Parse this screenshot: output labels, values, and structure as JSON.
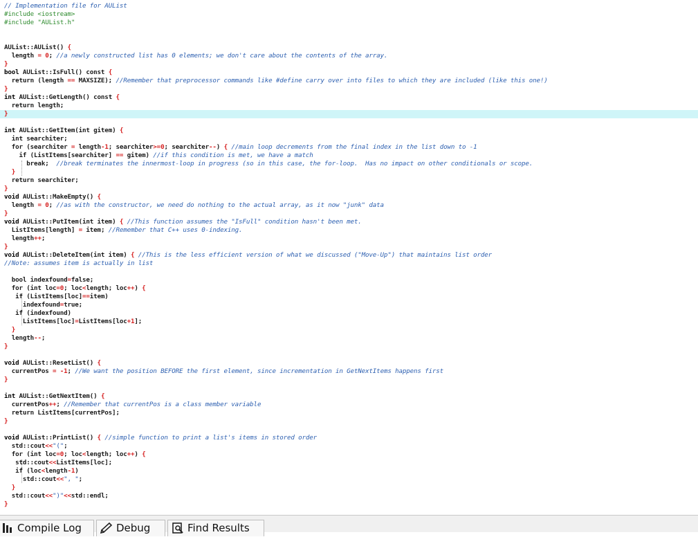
{
  "editor": {
    "highlighted_line": 13,
    "lines": [
      [
        [
          "cmt",
          "// Implementation file for AUList"
        ]
      ],
      [
        [
          "pp",
          "#include <iostream>"
        ]
      ],
      [
        [
          "pp",
          "#include \"AUList.h\""
        ]
      ],
      [],
      [],
      [
        [
          "txt",
          "AUList::AUList() "
        ],
        [
          "sym",
          "{"
        ]
      ],
      [
        [
          "txt",
          "  length "
        ],
        [
          "sym",
          "="
        ],
        [
          "txt",
          " "
        ],
        [
          "num",
          "0"
        ],
        [
          "txt",
          "; "
        ],
        [
          "cmt",
          "//a newly constructed list has 0 elements; we don't care about the contents of the array."
        ]
      ],
      [
        [
          "sym",
          "}"
        ]
      ],
      [
        [
          "kw",
          "bool"
        ],
        [
          "txt",
          " AUList::IsFull() const "
        ],
        [
          "sym",
          "{"
        ]
      ],
      [
        [
          "txt",
          "  return (length "
        ],
        [
          "sym",
          "=="
        ],
        [
          "txt",
          " MAXSIZE); "
        ],
        [
          "cmt",
          "//Remember that preprocessor commands like #define carry over into files to which they are included (like this one!)"
        ]
      ],
      [
        [
          "sym",
          "}"
        ]
      ],
      [
        [
          "kw",
          "int"
        ],
        [
          "txt",
          " AUList::GetLength() const "
        ],
        [
          "sym",
          "{"
        ]
      ],
      [
        [
          "txt",
          "  return length;"
        ]
      ],
      [
        [
          "sym",
          "}"
        ]
      ],
      [],
      [
        [
          "kw",
          "int"
        ],
        [
          "txt",
          " AUList::GetItem(int gitem) "
        ],
        [
          "sym",
          "{"
        ]
      ],
      [
        [
          "txt",
          "  int searchiter;"
        ]
      ],
      [
        [
          "txt",
          "  for (searchiter "
        ],
        [
          "sym",
          "="
        ],
        [
          "txt",
          " length"
        ],
        [
          "sym",
          "-"
        ],
        [
          "num",
          "1"
        ],
        [
          "txt",
          "; searchiter"
        ],
        [
          "sym",
          ">="
        ],
        [
          "num",
          "0"
        ],
        [
          "txt",
          "; searchiter"
        ],
        [
          "sym",
          "--"
        ],
        [
          "txt",
          ") "
        ],
        [
          "sym",
          "{"
        ],
        [
          "txt",
          " "
        ],
        [
          "cmt",
          "//main loop decrements from the final index in the list down to -1"
        ]
      ],
      [
        [
          "txt",
          "    if (ListItems[searchiter] "
        ],
        [
          "sym",
          "=="
        ],
        [
          "txt",
          " gitem) "
        ],
        [
          "cmt",
          "//if this condition is met, we have a match"
        ]
      ],
      [
        [
          "txt",
          "      break;  "
        ],
        [
          "cmt",
          "//break terminates the innermost-loop in progress (so in this case, the for-loop.  Has no impact on other conditionals or scope."
        ]
      ],
      [
        [
          "txt",
          "  "
        ],
        [
          "sym",
          "}"
        ]
      ],
      [
        [
          "txt",
          "  return searchiter;"
        ]
      ],
      [
        [
          "sym",
          "}"
        ]
      ],
      [
        [
          "kw",
          "void"
        ],
        [
          "txt",
          " AUList::MakeEmpty() "
        ],
        [
          "sym",
          "{"
        ]
      ],
      [
        [
          "txt",
          "  length "
        ],
        [
          "sym",
          "="
        ],
        [
          "txt",
          " "
        ],
        [
          "num",
          "0"
        ],
        [
          "txt",
          "; "
        ],
        [
          "cmt",
          "//as with the constructor, we need do nothing to the actual array, as it now \"junk\" data"
        ]
      ],
      [
        [
          "sym",
          "}"
        ]
      ],
      [
        [
          "kw",
          "void"
        ],
        [
          "txt",
          " AUList::PutItem(int item) "
        ],
        [
          "sym",
          "{"
        ],
        [
          "txt",
          " "
        ],
        [
          "cmt",
          "//This function assumes the \"IsFull\" condition hasn't been met."
        ]
      ],
      [
        [
          "txt",
          "  ListItems[length] "
        ],
        [
          "sym",
          "="
        ],
        [
          "txt",
          " item; "
        ],
        [
          "cmt",
          "//Remember that C++ uses 0-indexing."
        ]
      ],
      [
        [
          "txt",
          "  length"
        ],
        [
          "sym",
          "++"
        ],
        [
          "txt",
          ";"
        ]
      ],
      [
        [
          "sym",
          "}"
        ]
      ],
      [
        [
          "kw",
          "void"
        ],
        [
          "txt",
          " AUList::DeleteItem(int item) "
        ],
        [
          "sym",
          "{"
        ],
        [
          "txt",
          " "
        ],
        [
          "cmt",
          "//This is the less efficient version of what we discussed (\"Move-Up\") that maintains list order"
        ]
      ],
      [
        [
          "cmt",
          "//Note: assumes item is actually in list"
        ]
      ],
      [],
      [
        [
          "txt",
          "  bool indexfound"
        ],
        [
          "sym",
          "="
        ],
        [
          "txt",
          "false;"
        ]
      ],
      [
        [
          "txt",
          "  for (int loc"
        ],
        [
          "sym",
          "="
        ],
        [
          "num",
          "0"
        ],
        [
          "txt",
          "; loc"
        ],
        [
          "sym",
          "<"
        ],
        [
          "txt",
          "length; loc"
        ],
        [
          "sym",
          "++"
        ],
        [
          "txt",
          ") "
        ],
        [
          "sym",
          "{"
        ]
      ],
      [
        [
          "txt",
          "   if (ListItems[loc]"
        ],
        [
          "sym",
          "=="
        ],
        [
          "txt",
          "item)"
        ]
      ],
      [
        [
          "txt",
          "     indexfound"
        ],
        [
          "sym",
          "="
        ],
        [
          "txt",
          "true;"
        ]
      ],
      [
        [
          "txt",
          "   if (indexfound)"
        ]
      ],
      [
        [
          "txt",
          "     ListItems[loc]"
        ],
        [
          "sym",
          "="
        ],
        [
          "txt",
          "ListItems[loc"
        ],
        [
          "sym",
          "+"
        ],
        [
          "num",
          "1"
        ],
        [
          "txt",
          "];"
        ]
      ],
      [
        [
          "txt",
          "  "
        ],
        [
          "sym",
          "}"
        ]
      ],
      [
        [
          "txt",
          "  length"
        ],
        [
          "sym",
          "--"
        ],
        [
          "txt",
          ";"
        ]
      ],
      [
        [
          "sym",
          "}"
        ]
      ],
      [],
      [
        [
          "kw",
          "void"
        ],
        [
          "txt",
          " AUList::ResetList() "
        ],
        [
          "sym",
          "{"
        ]
      ],
      [
        [
          "txt",
          "  currentPos "
        ],
        [
          "sym",
          "="
        ],
        [
          "txt",
          " "
        ],
        [
          "sym",
          "-"
        ],
        [
          "num",
          "1"
        ],
        [
          "txt",
          "; "
        ],
        [
          "cmt",
          "//We want the position BEFORE the first element, since incrementation in GetNextItems happens first"
        ]
      ],
      [
        [
          "sym",
          "}"
        ]
      ],
      [],
      [
        [
          "kw",
          "int"
        ],
        [
          "txt",
          " AUList::GetNextItem() "
        ],
        [
          "sym",
          "{"
        ]
      ],
      [
        [
          "txt",
          "  currentPos"
        ],
        [
          "sym",
          "++"
        ],
        [
          "txt",
          "; "
        ],
        [
          "cmt",
          "//Remember that currentPos is a class member variable"
        ]
      ],
      [
        [
          "txt",
          "  return ListItems[currentPos];"
        ]
      ],
      [
        [
          "sym",
          "}"
        ]
      ],
      [],
      [
        [
          "kw",
          "void"
        ],
        [
          "txt",
          " AUList::PrintList() "
        ],
        [
          "sym",
          "{"
        ],
        [
          "txt",
          " "
        ],
        [
          "cmt",
          "//simple function to print a list's items in stored order"
        ]
      ],
      [
        [
          "txt",
          "  std::cout"
        ],
        [
          "sym",
          "<<"
        ],
        [
          "str",
          "\"(\""
        ],
        [
          "txt",
          ";"
        ]
      ],
      [
        [
          "txt",
          "  for (int loc"
        ],
        [
          "sym",
          "="
        ],
        [
          "num",
          "0"
        ],
        [
          "txt",
          "; loc"
        ],
        [
          "sym",
          "<"
        ],
        [
          "txt",
          "length; loc"
        ],
        [
          "sym",
          "++"
        ],
        [
          "txt",
          ") "
        ],
        [
          "sym",
          "{"
        ]
      ],
      [
        [
          "txt",
          "   std::cout"
        ],
        [
          "sym",
          "<<"
        ],
        [
          "txt",
          "ListItems[loc];"
        ]
      ],
      [
        [
          "txt",
          "   if (loc"
        ],
        [
          "sym",
          "<"
        ],
        [
          "txt",
          "length"
        ],
        [
          "sym",
          "-"
        ],
        [
          "num",
          "1"
        ],
        [
          "txt",
          ")"
        ]
      ],
      [
        [
          "txt",
          "     std::cout"
        ],
        [
          "sym",
          "<<"
        ],
        [
          "str",
          "\", \""
        ],
        [
          "txt",
          ";"
        ]
      ],
      [
        [
          "txt",
          "  "
        ],
        [
          "sym",
          "}"
        ]
      ],
      [
        [
          "txt",
          "  std::cout"
        ],
        [
          "sym",
          "<<"
        ],
        [
          "str",
          "\")\""
        ],
        [
          "sym",
          "<<"
        ],
        [
          "txt",
          "std::endl;"
        ]
      ],
      [
        [
          "sym",
          "}"
        ]
      ]
    ]
  },
  "bottom_tabs": [
    {
      "label": "Compile Log",
      "icon": "compile-log-icon"
    },
    {
      "label": "Debug",
      "icon": "debug-icon"
    },
    {
      "label": "Find Results",
      "icon": "find-results-icon"
    }
  ]
}
